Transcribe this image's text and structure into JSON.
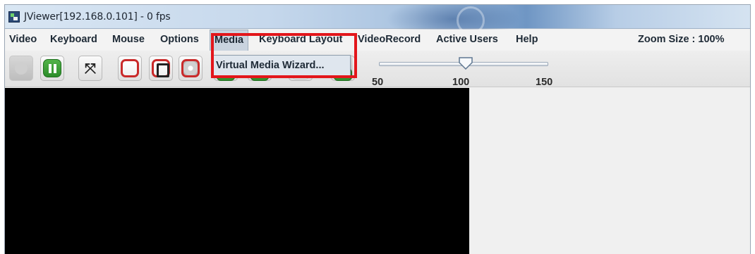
{
  "window": {
    "title": "JViewer[192.168.0.101] - 0 fps"
  },
  "menubar": {
    "items": [
      {
        "label": "Video"
      },
      {
        "label": "Keyboard"
      },
      {
        "label": "Mouse"
      },
      {
        "label": "Options"
      },
      {
        "label": "Media"
      },
      {
        "label": "Keyboard Layout"
      },
      {
        "label": "VideoRecord"
      },
      {
        "label": "Active Users"
      },
      {
        "label": "Help"
      }
    ],
    "zoom_label": "Zoom Size : 100%"
  },
  "media_menu": {
    "items": [
      {
        "label": "Virtual Media Wizard..."
      }
    ]
  },
  "toolbar": {
    "buttons": [
      {
        "icon": "play-icon"
      },
      {
        "icon": "pause-icon"
      },
      {
        "icon": "fullscreen-icon"
      },
      {
        "icon": "floppy-icon"
      },
      {
        "icon": "hard-disk-icon"
      },
      {
        "icon": "cd-icon"
      }
    ],
    "zoom_slider": {
      "min": 50,
      "max": 150,
      "value": 100,
      "labels": [
        "50",
        "100",
        "150"
      ]
    }
  },
  "colors": {
    "highlight": "#e3161b",
    "video_background": "#000000",
    "menu_active": "#c9d3df"
  }
}
